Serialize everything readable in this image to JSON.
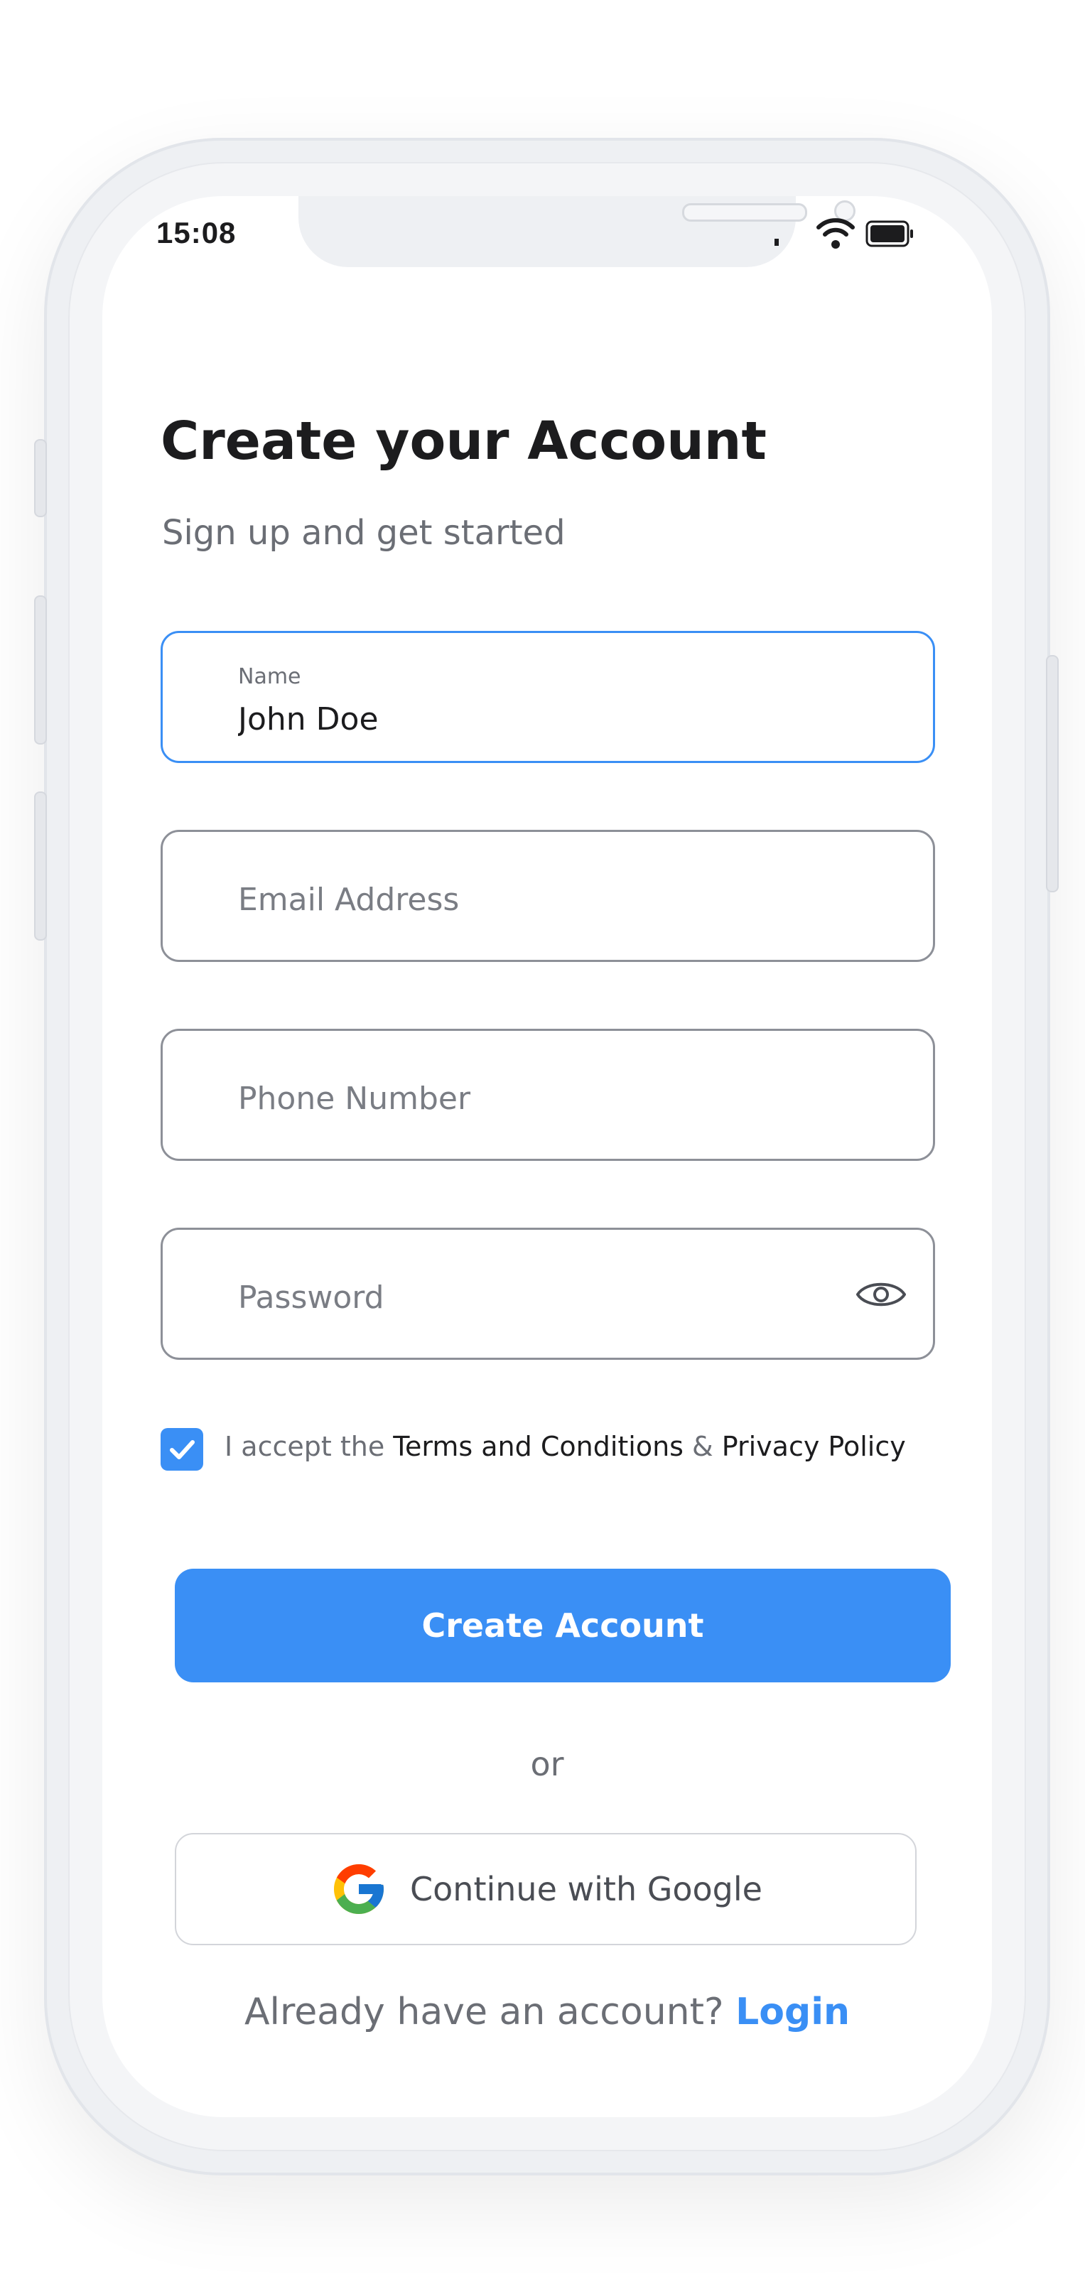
{
  "status_bar": {
    "time": "15:08",
    "icons": [
      "signal-icon",
      "wifi-icon",
      "battery-icon"
    ]
  },
  "header": {
    "title": "Create your Account",
    "subtitle": "Sign up and get started"
  },
  "form": {
    "name": {
      "label": "Name",
      "value": "John Doe"
    },
    "email": {
      "placeholder": "Email Address"
    },
    "phone": {
      "placeholder": "Phone Number"
    },
    "password": {
      "placeholder": "Password",
      "toggle_icon": "eye-icon"
    },
    "terms": {
      "checked": true,
      "prefix": "I accept the ",
      "terms_link": "Terms and Conditions",
      "connector": " & ",
      "privacy_link": "Privacy Policy"
    }
  },
  "actions": {
    "create_account": "Create Account",
    "or": "or",
    "google": "Continue with Google",
    "google_icon": "google-icon"
  },
  "footer": {
    "prompt": "Already have an account? ",
    "login": "Login"
  },
  "colors": {
    "accent": "#3a8ff5",
    "text_primary": "#1c1c1e",
    "text_secondary": "#6b6e75"
  }
}
